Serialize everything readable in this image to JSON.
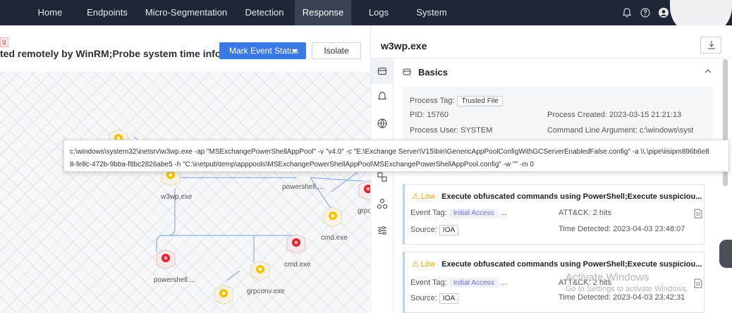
{
  "nav": {
    "items": [
      "Home",
      "Endpoints",
      "Micro-Segmentation",
      "Detection",
      "Response",
      "Logs",
      "System"
    ],
    "active": "Response"
  },
  "event": {
    "tag": "g",
    "title": "ted remotely by WinRM;Probe system time inform...",
    "mark_button": "Mark Event Status",
    "isolate_button": "Isolate"
  },
  "graph": {
    "nodes": {
      "w3wp": "w3wp.exe",
      "powershell_top": "powershell....",
      "grpc_edge": "grpc",
      "cmd1": "cmd.exe",
      "cmd2": "cmd.exe",
      "powershell_bottom": "powershell....",
      "grpconv": "grpconv.exe"
    }
  },
  "panel": {
    "title": "w3wp.exe",
    "section": "Basics",
    "process_tag_label": "Process Tag:",
    "process_tag_value": "Trusted File",
    "pid": "PID: 15760",
    "process_created": "Process Created: 2023-03-15 21:21:13",
    "process_user": "Process User: SYSTEM",
    "cmdline": "Command Line Argument: c:\\windows\\syst"
  },
  "tooltip": {
    "line1": "c:\\windows\\system32\\inetsrv\\w3wp.exe -ap \"MSExchangePowerShellAppPool\" -v \"v4.0\" -c \"E:\\Exchange Server\\V15\\bin\\GenericAppPoolConfigWithGCServerEnabledFalse.config\" -a \\\\.\\pipe\\iisipm896b6e8",
    "line2": "8-fe8c-472b-9bba-f8bc2826abe5 -h \"C:\\inetpub\\temp\\apppools\\MSExchangePowerShellAppPool\\MSExchangePowerShellAppPool.config\" -w \"\" -m 0"
  },
  "alerts": [
    {
      "level": "Low",
      "title": "Execute obfuscated commands using PowerShell;Execute suspiciou...",
      "event_tag_label": "Event Tag:",
      "event_tag": "Initial Access",
      "ellipsis": "...",
      "attck": "ATT&CK: 2 hits",
      "source_label": "Source:",
      "source": "IOA",
      "time": "Time Detected: 2023-04-03 23:48:07"
    },
    {
      "level": "Low",
      "title": "Execute obfuscated commands using PowerShell;Execute suspiciou...",
      "event_tag_label": "Event Tag:",
      "event_tag": "Initial Access",
      "ellipsis": "...",
      "attck": "ATT&CK: 2 hits",
      "source_label": "Source:",
      "source": "IOA",
      "time": "Time Detected: 2023-04-03 23:42:31"
    }
  ],
  "watermark": {
    "line1": "Activate Windows",
    "line2": "Go to Settings to activate Windows."
  },
  "colors": {
    "nav_bg": "#1f2636",
    "primary": "#3a78e6",
    "low": "#f0a500",
    "threat": "#d8262b",
    "warn": "#f2c200"
  },
  "icons": [
    "bell-icon",
    "help-icon",
    "user-icon",
    "download-icon",
    "collapse-icon",
    "basics-icon",
    "alert-icon",
    "globe-icon",
    "network-icon",
    "hierarchy-icon",
    "filter-icon",
    "document-icon"
  ]
}
